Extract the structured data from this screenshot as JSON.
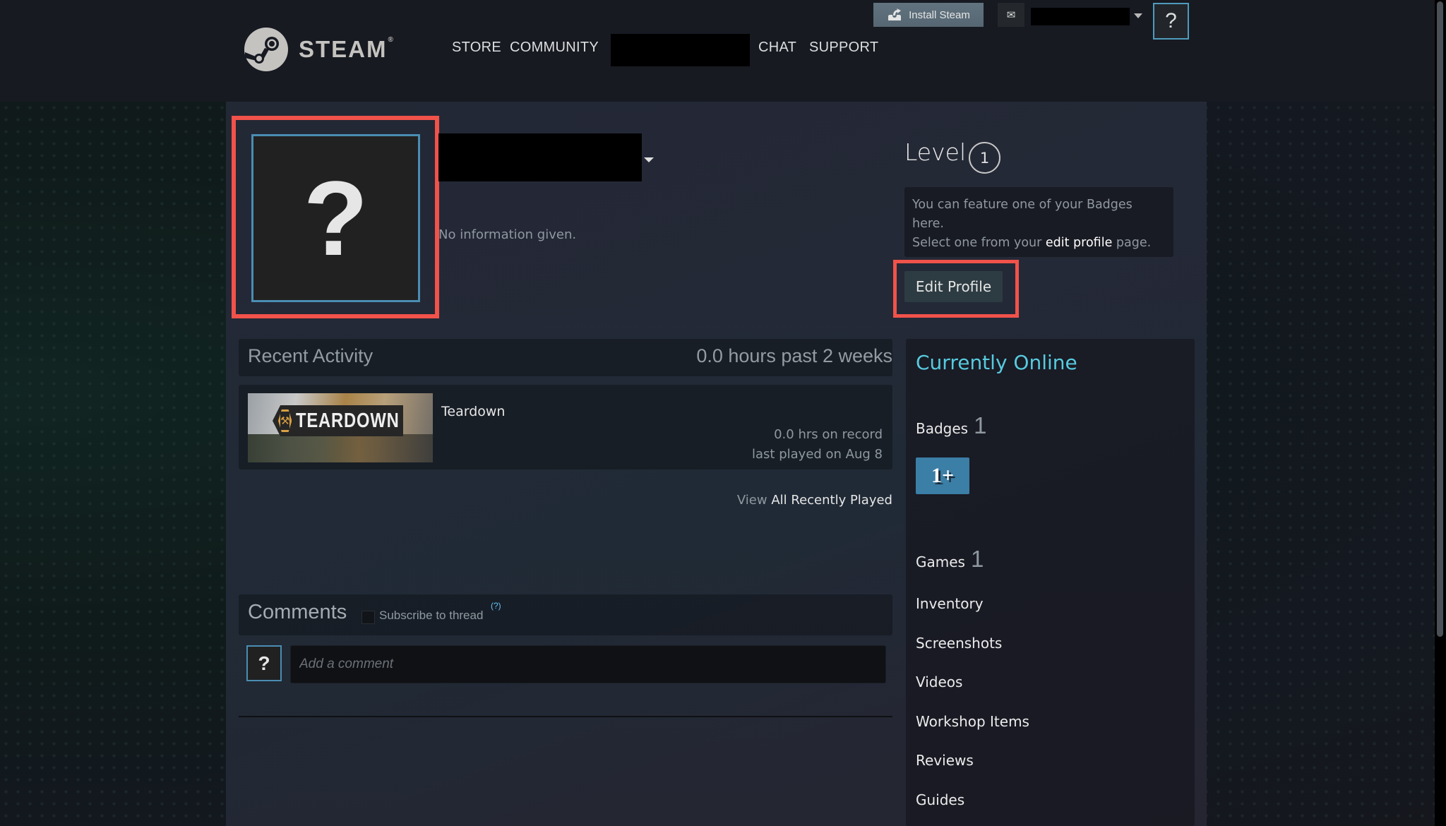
{
  "header": {
    "logo_text": "STEAM",
    "logo_reg": "®",
    "nav": [
      "STORE",
      "COMMUNITY",
      "CHAT",
      "SUPPORT"
    ],
    "install_label": "Install Steam",
    "help_label": "?"
  },
  "profile": {
    "avatar_placeholder": "?",
    "summary": "No information given.",
    "level_label": "Level",
    "level": "1",
    "badge_feature_line1": "You can feature one of your Badges here.",
    "badge_feature_pre": "Select one from your ",
    "badge_feature_link": "edit profile",
    "badge_feature_post": " page.",
    "edit_profile_label": "Edit Profile"
  },
  "recent_activity": {
    "title": "Recent Activity",
    "hours_summary": "0.0 hours past 2 weeks",
    "games": [
      {
        "name": "Teardown",
        "logo_text": "TEARDOWN",
        "hours": "0.0 hrs on record",
        "last_played": "last played on Aug 8"
      }
    ],
    "view_prefix": "View",
    "view_link": "All Recently Played"
  },
  "comments": {
    "title": "Comments",
    "subscribe_label": "Subscribe to thread",
    "help_marker": "(?)",
    "avatar_placeholder": "?",
    "input_placeholder": "Add a comment"
  },
  "sidebar": {
    "status": "Currently Online",
    "badges_label": "Badges",
    "badges_count": "1",
    "badge_icon_text": "1+",
    "games_label": "Games",
    "games_count": "1",
    "links": [
      "Inventory",
      "Screenshots",
      "Videos",
      "Workshop Items",
      "Reviews",
      "Guides"
    ]
  },
  "colors": {
    "highlight_red": "#f1524a",
    "online_blue": "#57cbde",
    "avatar_border": "#4a8db3"
  }
}
